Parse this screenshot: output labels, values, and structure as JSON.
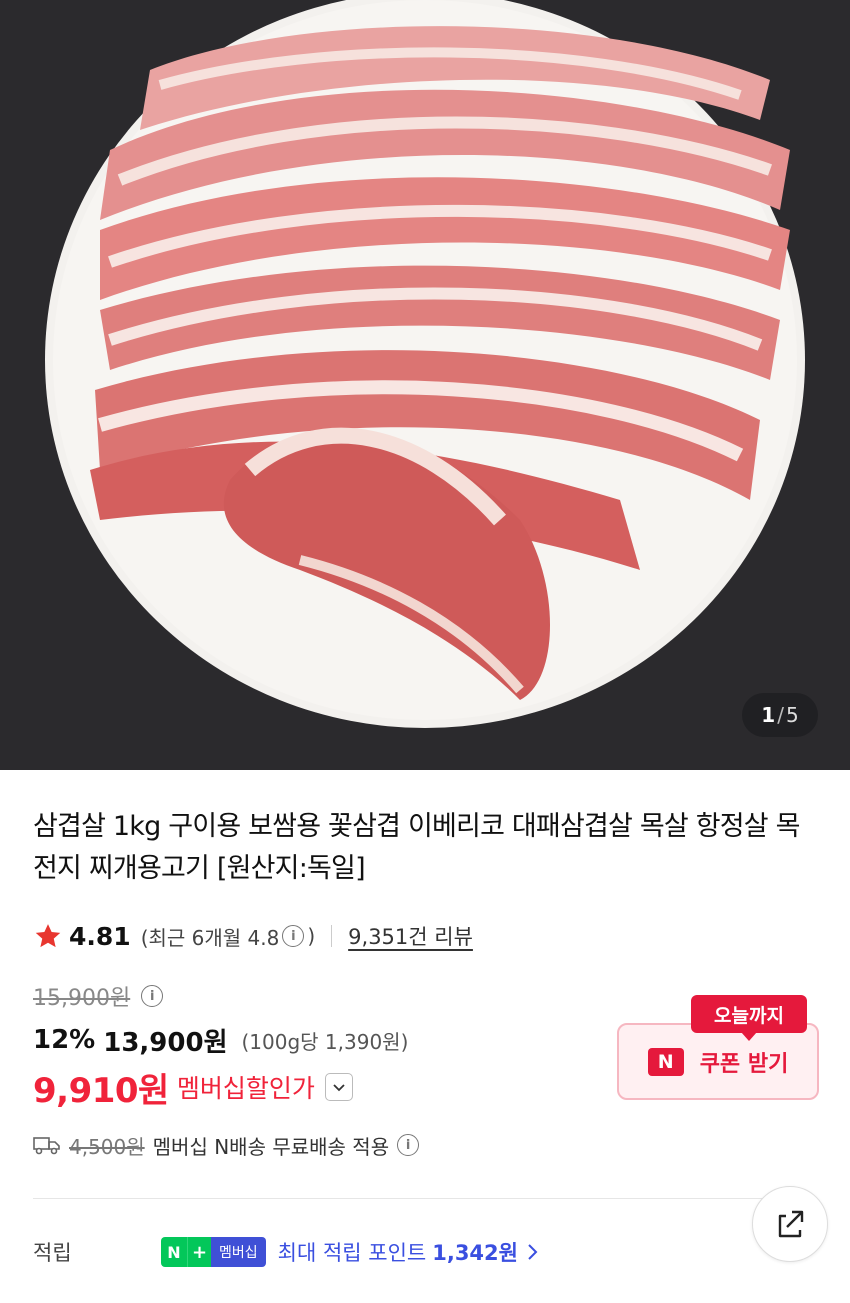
{
  "gallery": {
    "current": "1",
    "separator": "/",
    "total": "5",
    "image_alt": "삼겹살 상품 이미지"
  },
  "product": {
    "title": "삼겹살 1kg 구이용 보쌈용 꽃삼겹 이베리코 대패삼겹살 목살 항정살 목전지 찌개용고기 [원산지:독일]"
  },
  "rating": {
    "score": "4.81",
    "recent_open": "(최근 6개월 4.8",
    "recent_close": ")",
    "review_count": "9,351건 리뷰"
  },
  "pricing": {
    "original_price": "15,900원",
    "discount_rate": "12%",
    "sale_price": "13,900원",
    "unit_price": "(100g당 1,390원)",
    "member_price": "9,910원",
    "member_label": "멤버십할인가"
  },
  "coupon": {
    "tag": "오늘까지",
    "badge": "N",
    "label": "쿠폰 받기"
  },
  "shipping": {
    "fee": "4,500원",
    "text": "멤버십 N배송 무료배송 적용"
  },
  "points": {
    "label": "적립",
    "badge_n": "N",
    "badge_plus": "+",
    "badge_membership": "멤버십",
    "text": "최대 적립 포인트",
    "amount": "1,342원"
  },
  "colors": {
    "accent_red": "#e5193c",
    "member_red": "#f0233a",
    "point_blue": "#3a4fe0",
    "naver_green": "#03c75a",
    "star": "#e8362f"
  }
}
